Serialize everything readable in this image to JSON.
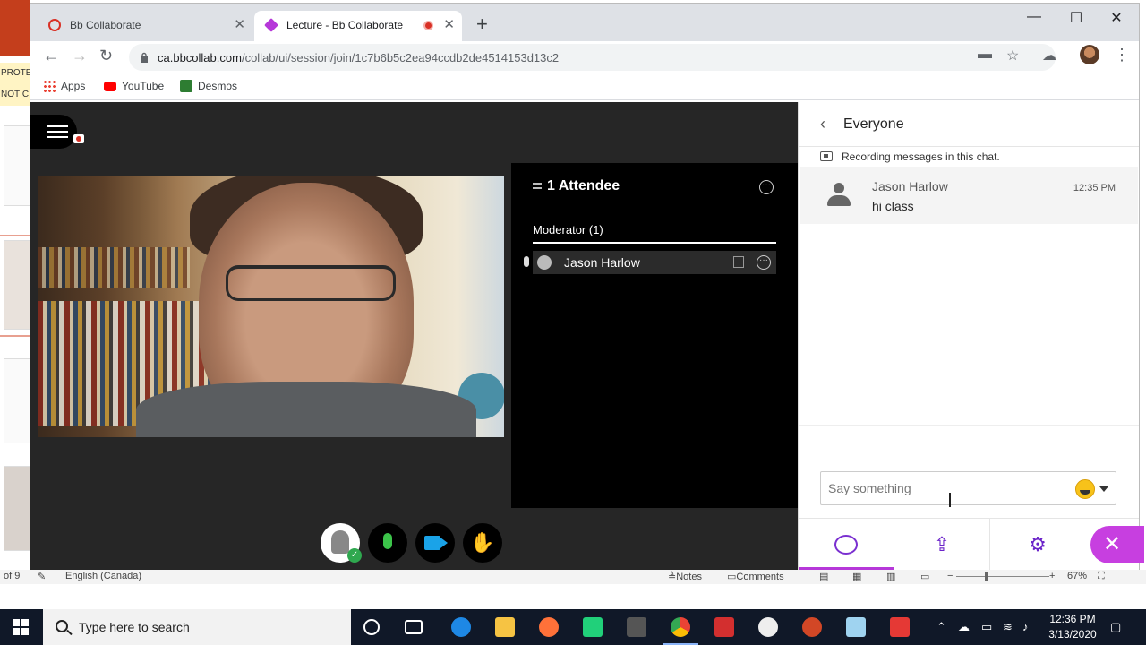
{
  "background_app": {
    "notice_lines": [
      "PROTE",
      "NOTIC"
    ],
    "status": {
      "page": "of 9",
      "language": "English (Canada)",
      "notes": "Notes",
      "comments": "Comments",
      "zoom": "67%"
    }
  },
  "browser": {
    "tabs": [
      {
        "label": "Bb Collaborate",
        "active": false
      },
      {
        "label": "Lecture - Bb Collaborate",
        "active": true,
        "recording": true
      }
    ],
    "url_host": "ca.bbcollab.com",
    "url_path": "/collab/ui/session/join/1c7b6b5c2ea94ccdb2de4514153d13c2",
    "bookmarks": [
      {
        "label": "Apps",
        "icon": "apps-grid-icon"
      },
      {
        "label": "YouTube",
        "icon": "youtube-icon"
      },
      {
        "label": "Desmos",
        "icon": "desmos-icon"
      }
    ]
  },
  "session": {
    "attendees_title": "1 Attendee",
    "moderator_label": "Moderator (1)",
    "attendee_name": "Jason Harlow"
  },
  "chat": {
    "title": "Everyone",
    "recording_note": "Recording messages in this chat.",
    "messages": [
      {
        "sender": "Jason Harlow",
        "time": "12:35 PM",
        "text": "hi class"
      }
    ],
    "input_placeholder": "Say something"
  },
  "taskbar": {
    "search_placeholder": "Type here to search",
    "time": "12:36 PM",
    "date": "3/13/2020"
  },
  "colors": {
    "accent_purple": "#c73fe0",
    "mic_green": "#3cc44a",
    "camera_blue": "#1aa3e8",
    "recording_red": "#d93025"
  }
}
